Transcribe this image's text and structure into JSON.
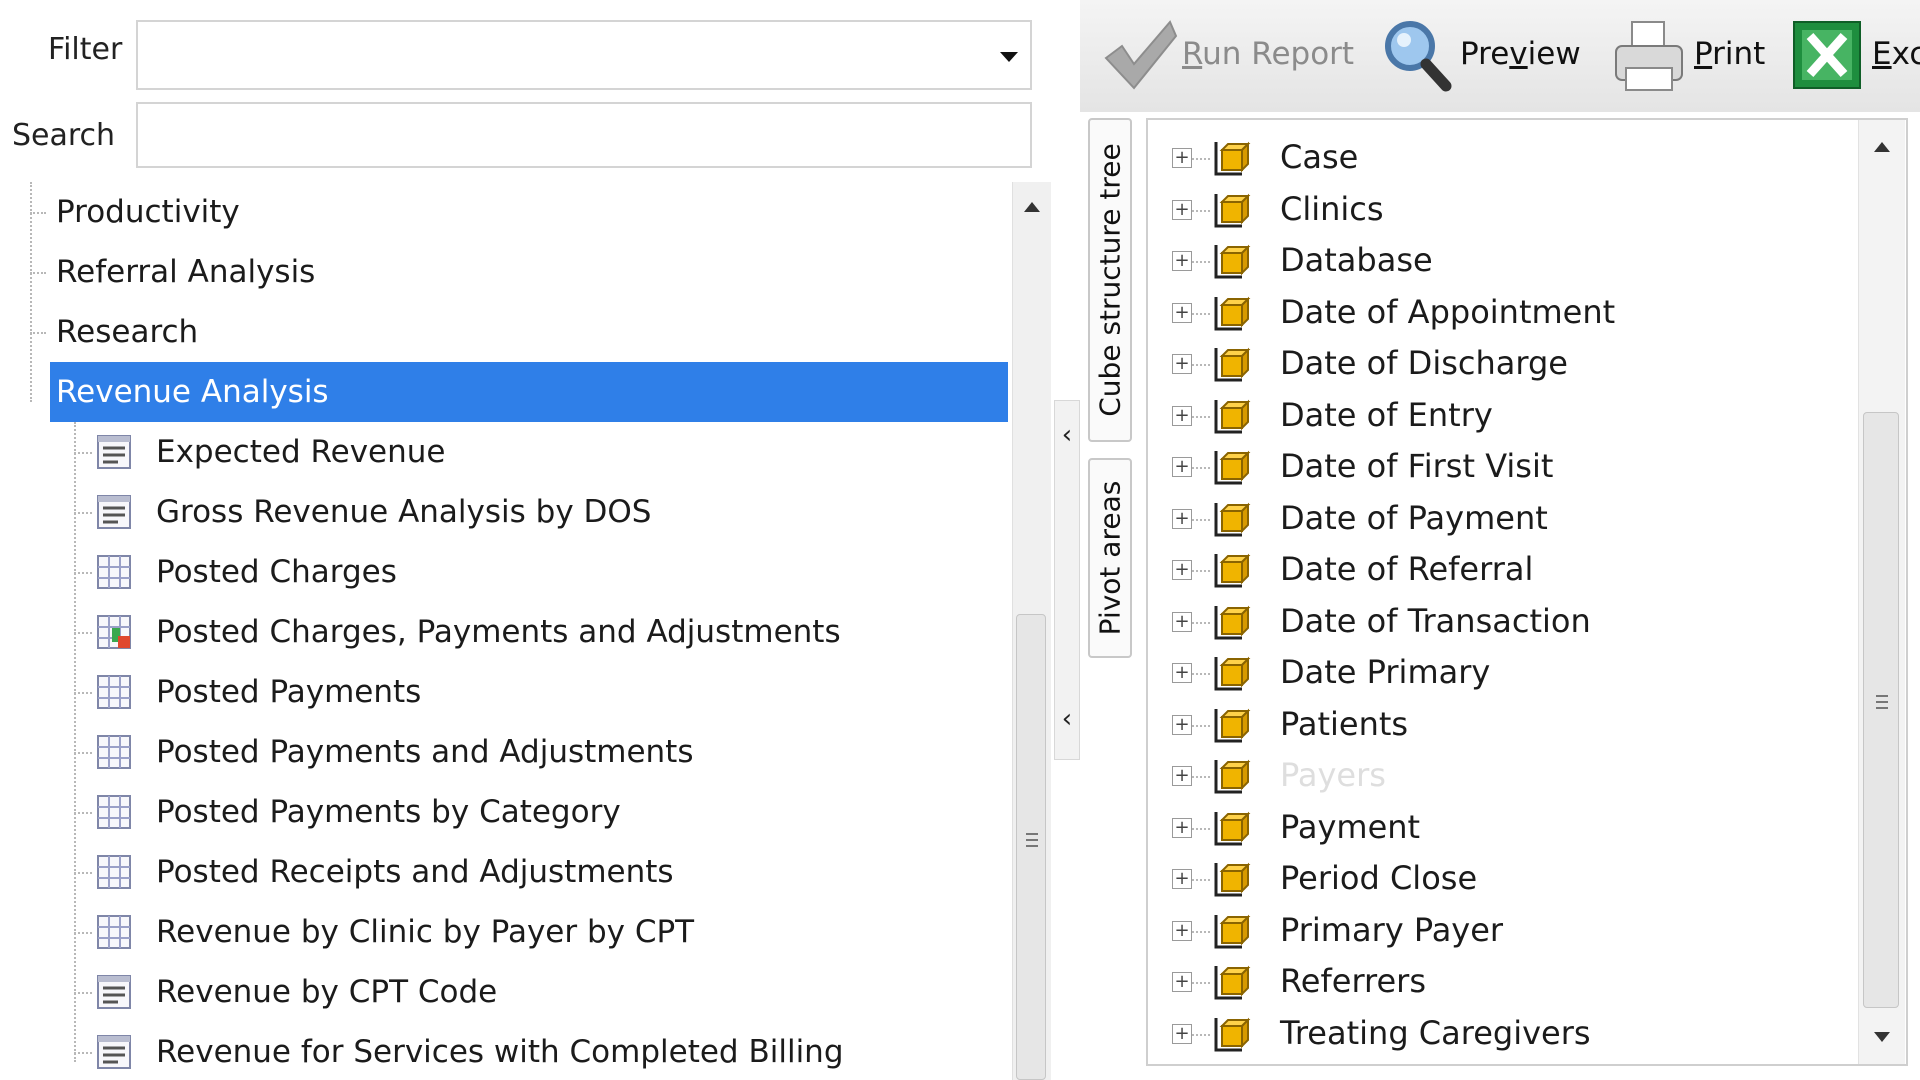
{
  "filter": {
    "label": "Filter",
    "value": ""
  },
  "search": {
    "label": "Search",
    "value": ""
  },
  "categories": [
    {
      "label": "Productivity"
    },
    {
      "label": "Referral Analysis"
    },
    {
      "label": "Research"
    },
    {
      "label": "Revenue Analysis",
      "selected": true
    }
  ],
  "reports": [
    {
      "label": "Expected Revenue",
      "icon": "report-list-icon"
    },
    {
      "label": "Gross Revenue Analysis by DOS",
      "icon": "report-list-icon"
    },
    {
      "label": "Posted Charges",
      "icon": "grid-report-icon"
    },
    {
      "label": "Posted Charges, Payments and Adjustments",
      "icon": "chart-report-icon"
    },
    {
      "label": "Posted Payments",
      "icon": "grid-report-icon"
    },
    {
      "label": "Posted Payments and Adjustments",
      "icon": "grid-report-icon"
    },
    {
      "label": "Posted Payments by Category",
      "icon": "grid-report-icon"
    },
    {
      "label": "Posted Receipts and Adjustments",
      "icon": "grid-report-icon"
    },
    {
      "label": "Revenue by Clinic by Payer by CPT",
      "icon": "grid-report-icon"
    },
    {
      "label": "Revenue by CPT Code",
      "icon": "report-list-icon"
    },
    {
      "label": "Revenue for Services with Completed Billing",
      "icon": "report-list-icon"
    }
  ],
  "toolbar": {
    "run_report": {
      "accel": "R",
      "rest": "un Report",
      "icon": "checkmark-icon",
      "enabled": false
    },
    "preview": {
      "pre": "Pre",
      "accel": "v",
      "rest": "iew",
      "icon": "magnifier-icon"
    },
    "print": {
      "accel": "P",
      "rest": "rint",
      "icon": "printer-icon"
    },
    "export": {
      "accel": "E",
      "rest": "xc",
      "icon": "excel-icon"
    }
  },
  "vertical_tabs": {
    "cube_structure_tree": "Cube structure tree",
    "pivot_areas": "Pivot areas"
  },
  "dimensions": [
    {
      "label": "Case"
    },
    {
      "label": "Clinics"
    },
    {
      "label": "Database"
    },
    {
      "label": "Date of Appointment"
    },
    {
      "label": "Date of Discharge"
    },
    {
      "label": "Date of Entry"
    },
    {
      "label": "Date of First Visit"
    },
    {
      "label": "Date of Payment"
    },
    {
      "label": "Date of Referral"
    },
    {
      "label": "Date of Transaction"
    },
    {
      "label": "Date Primary"
    },
    {
      "label": "Patients"
    },
    {
      "label": "Payers",
      "faded": true
    },
    {
      "label": "Payment"
    },
    {
      "label": "Period Close"
    },
    {
      "label": "Primary Payer"
    },
    {
      "label": "Referrers"
    },
    {
      "label": "Treating Caregivers"
    }
  ],
  "colors": {
    "selection": "#2f7fe8",
    "cube_icon": "#f0b400",
    "excel": "#1e8e3e"
  }
}
